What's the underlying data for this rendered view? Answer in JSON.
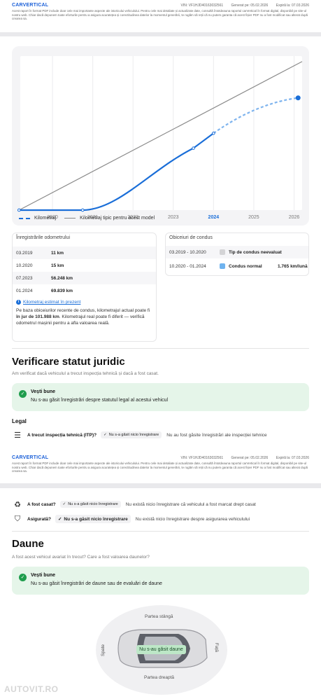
{
  "header": {
    "brand": "CARVERTICAL",
    "vin": "VIN: VF1HJD40163032561",
    "generated": "Generat pe: 05.02.2026",
    "expires": "Expiră la: 07.03.2026",
    "disclaimer": "Acest raport în format PDF include doar cele mai importante aspecte ale istoricului vehiculului. Pentru cele mai detaliate și actualizate date, consultă întotdeauna raportul carVertical în format digital, disponibil pe site-ul nostru web. Chiar dacă depunem toate eforturile pentru a asigura acuratețea și corectitudinea datelor la momentul generării, te rugăm să reții că nu putem garanta că acest fișier PDF nu a fost modificat sau alterat după crearea sa."
  },
  "chart_data": {
    "type": "line",
    "x_ticks": [
      "2020",
      "2021",
      "2022",
      "2023",
      "2024",
      "2025",
      "2026"
    ],
    "highlight_tick": "2024",
    "xlim": [
      2019.2,
      2026.2
    ],
    "ylim": [
      0,
      140000
    ],
    "series": [
      {
        "name": "Kilometraj",
        "color": "#1a6ed8",
        "points": [
          [
            2019.17,
            11
          ],
          [
            2020.75,
            15
          ],
          [
            2023.5,
            56248
          ],
          [
            2024.0,
            69839
          ]
        ],
        "projection": [
          [
            2024.0,
            69839
          ],
          [
            2026.1,
            101988
          ]
        ]
      },
      {
        "name": "Kilometraj tipic pentru acest model",
        "color": "#8a8a8a",
        "points": [
          [
            2019.17,
            0
          ],
          [
            2026.2,
            135000
          ]
        ]
      }
    ],
    "legend": [
      "Kilometraj",
      "Kilometraj tipic pentru acest model"
    ]
  },
  "odometer": {
    "title": "Înregistrările odometrului",
    "rows": [
      {
        "date": "03.2019",
        "value": "11 km"
      },
      {
        "date": "10.2020",
        "value": "15 km"
      },
      {
        "date": "07.2023",
        "value": "56.248 km"
      },
      {
        "date": "01.2024",
        "value": "69.839 km"
      }
    ],
    "estimate_link": "Kilometraj estimat în prezent",
    "estimate_pre": "Pe baza obiceiurilor recente de condus, kilometrajul actual poate fi ",
    "estimate_bold": "în jur de 101.988 km",
    "estimate_post": ". Kilometrajul real poate fi diferit — verifică odometrul mașinii pentru a afla valoarea reală."
  },
  "habits": {
    "title": "Obiceiuri de condus",
    "rows": [
      {
        "period": "03.2019 - 10.2020",
        "type": "Tip de condus neevaluat",
        "color": "#d4d4d6",
        "rate": ""
      },
      {
        "period": "10.2020 - 01.2024",
        "type": "Condus normal",
        "color": "#6fb3ef",
        "rate": "1.765 km/lună"
      }
    ]
  },
  "legal": {
    "heading": "Verificare statut juridic",
    "subtitle": "Am verificat dacă vehiculul a trecut inspecția tehnică și dacă a fost casat.",
    "good_title": "Vești bune",
    "good_text": "Nu s-au găsit înregistrări despre statutul legal al acestui vehicul",
    "section": "Legal",
    "items": [
      {
        "label": "A trecut inspecția tehnică (ITP)?",
        "pill": "Nu s-a găsit nicio înregistrare",
        "text": "Nu au fost găsite înregistrări ale inspecției tehnice"
      },
      {
        "label": "A fost casat?",
        "pill": "Nu s-a găsit nicio înregistrare",
        "text": "Nu există nicio înregistrare că vehiculul a fost marcat drept casat"
      },
      {
        "label": "Asigurată?",
        "pill": "Nu s-a găsit nicio înregistrare",
        "text": "Nu există nicio înregistrare despre asigurarea vehiculului"
      }
    ]
  },
  "damage": {
    "heading": "Daune",
    "subtitle": "A fost acest vehicul avariat în trecut? Care a fost valoarea daunelor?",
    "good_title": "Vești bune",
    "good_text": "Nu s-au găsit înregistrări de daune sau de evaluări de daune",
    "left": "Partea stângă",
    "right": "Partea dreaptă",
    "back": "Spate",
    "front": "Față",
    "no_damage": "Nu s-au găsit daune"
  },
  "watermark": "AUTOVIT.RO"
}
